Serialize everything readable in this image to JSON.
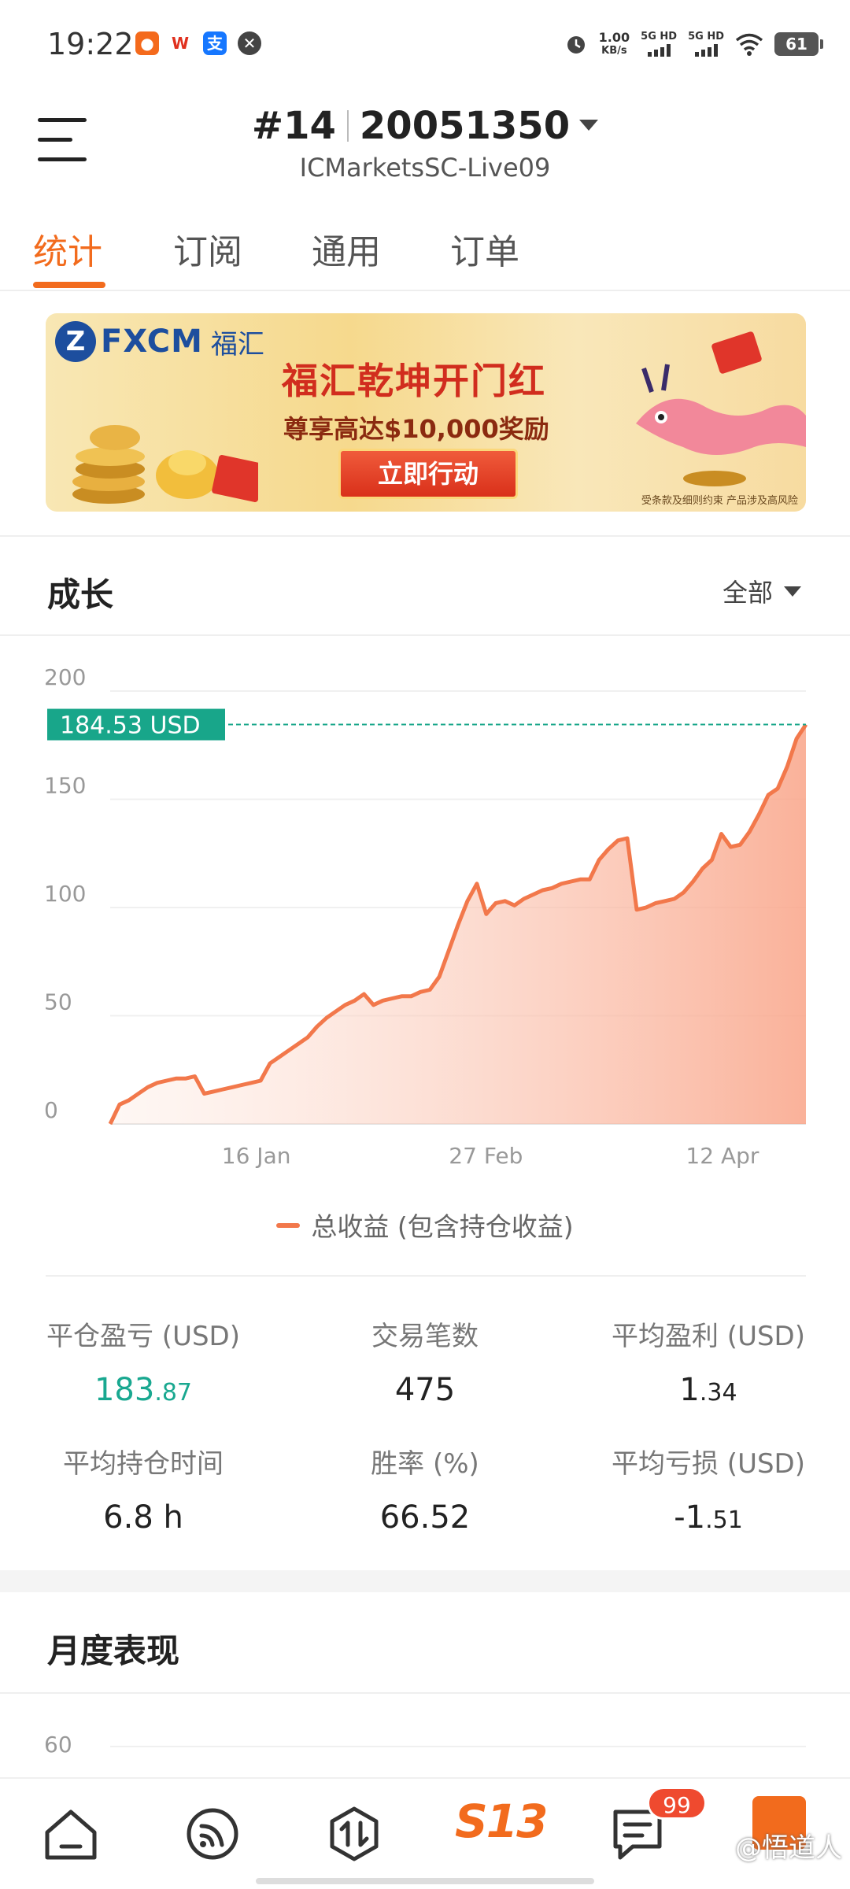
{
  "status_bar": {
    "time": "19:22",
    "net_speed_value": "1.00",
    "net_speed_unit": "KB/s",
    "network_1": "5G HD",
    "network_2": "5G HD",
    "battery": "61"
  },
  "header": {
    "rank": "#14",
    "account_number": "20051350",
    "server": "ICMarketsSC-Live09"
  },
  "tabs": [
    {
      "label": "统计",
      "active": true
    },
    {
      "label": "订阅",
      "active": false
    },
    {
      "label": "通用",
      "active": false
    },
    {
      "label": "订单",
      "active": false
    }
  ],
  "banner": {
    "brand": "FXCM",
    "brand_cn": "福汇",
    "title": "福汇乾坤开门红",
    "subtitle": "尊享高达$10,000奖励",
    "cta": "立即行动",
    "note": "受条款及细则约束  产品涉及高风险"
  },
  "growth": {
    "title": "成长",
    "filter": "全部",
    "legend": "总收益 (包含持仓收益)"
  },
  "chart_data": {
    "type": "area",
    "ylim": [
      0,
      200
    ],
    "y_ticks": [
      "200",
      "150",
      "100",
      "50",
      "0"
    ],
    "x_tick_labels": [
      "16 Jan",
      "27 Feb",
      "12 Apr"
    ],
    "current_value_label": "184.53 USD",
    "current_value": 184.53,
    "series": [
      {
        "name": "总收益 (包含持仓收益)",
        "color": "#f2784b",
        "values": [
          0,
          9,
          11,
          14,
          17,
          19,
          20,
          21,
          21,
          22,
          14,
          15,
          16,
          17,
          18,
          19,
          20,
          28,
          31,
          34,
          37,
          40,
          45,
          49,
          52,
          55,
          57,
          60,
          55,
          57,
          58,
          59,
          59,
          61,
          62,
          68,
          80,
          92,
          103,
          111,
          97,
          102,
          103,
          101,
          104,
          106,
          108,
          109,
          111,
          112,
          113,
          113,
          122,
          127,
          131,
          132,
          99,
          100,
          102,
          103,
          104,
          107,
          112,
          118,
          122,
          134,
          128,
          129,
          135,
          143,
          152,
          155,
          165,
          178,
          184.53
        ]
      }
    ]
  },
  "stats": [
    {
      "label": "平仓盈亏 (USD)",
      "int": "183",
      "dec": ".87",
      "highlight": true
    },
    {
      "label": "交易笔数",
      "int": "475",
      "dec": "",
      "highlight": false
    },
    {
      "label": "平均盈利 (USD)",
      "int": "1",
      "dec": ".34",
      "highlight": false
    },
    {
      "label": "平均持仓时间",
      "int": "6.8 h",
      "dec": "",
      "highlight": false
    },
    {
      "label": "胜率 (%)",
      "int": "66.52",
      "dec": "",
      "highlight": false
    },
    {
      "label": "平均亏损 (USD)",
      "int": "-1",
      "dec": ".51",
      "highlight": false
    }
  ],
  "monthly": {
    "title": "月度表现",
    "y_top": "60"
  },
  "bottom_nav": {
    "center_logo": "S13",
    "badge": "99",
    "watermark": "@悟道人"
  },
  "colors": {
    "accent": "#f26b1d",
    "line": "#f2784b",
    "positive": "#19a890",
    "value_tag": "#18a68a"
  }
}
